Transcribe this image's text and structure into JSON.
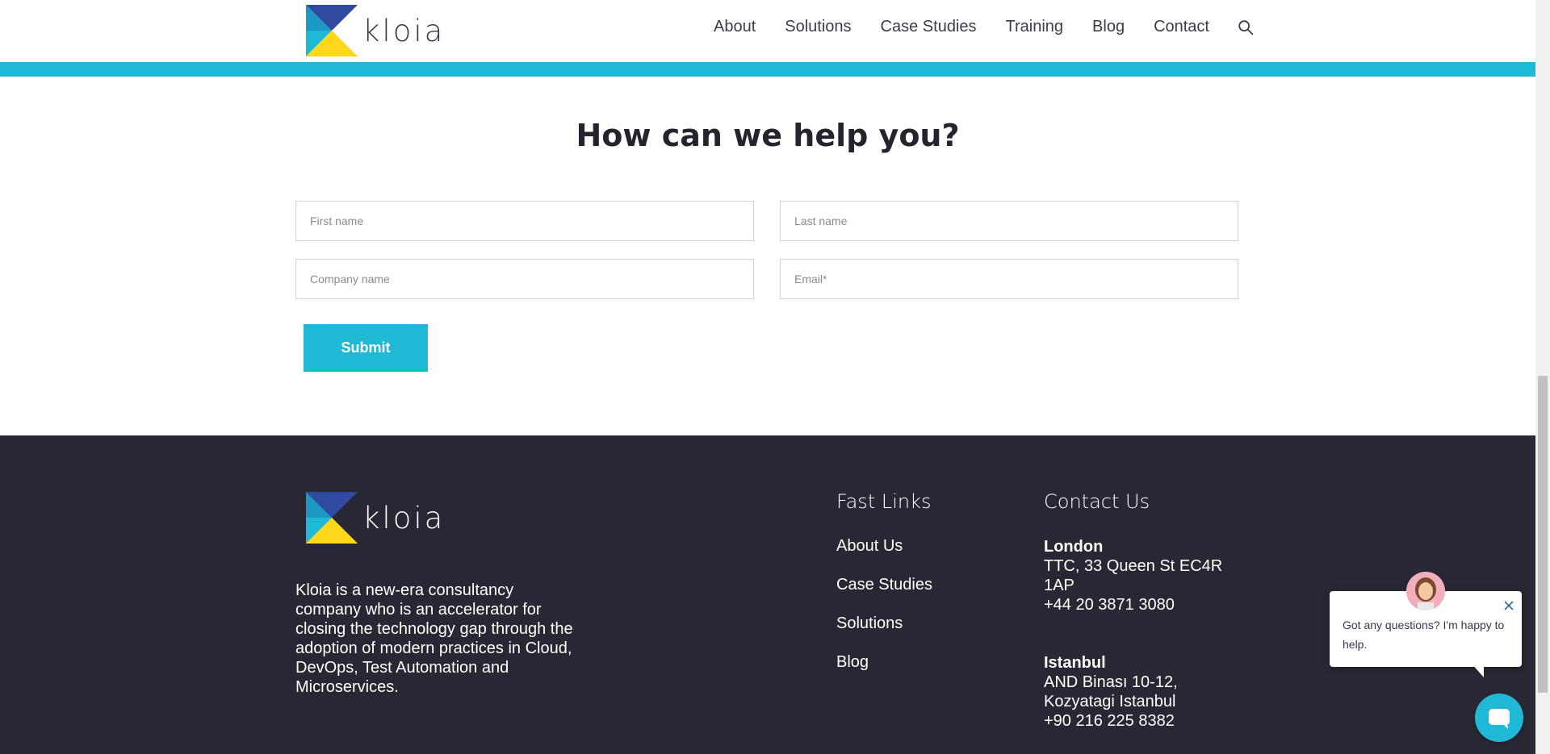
{
  "brand": {
    "name": "kloia",
    "accent_color": "#1fb8d5",
    "footer_bg": "#272833"
  },
  "nav": {
    "items": [
      "About",
      "Solutions",
      "Case Studies",
      "Training",
      "Blog",
      "Contact"
    ],
    "search_icon": "search-icon"
  },
  "form": {
    "title": "How can we help you?",
    "first_name_placeholder": "First name",
    "last_name_placeholder": "Last name",
    "company_placeholder": "Company name",
    "email_placeholder": "Email*",
    "submit_label": "Submit"
  },
  "footer": {
    "description": "Kloia is a new-era consultancy company who is an accelerator for closing the technology gap through the adoption of modern practices in Cloud, DevOps, Test Automation and Microservices.",
    "fast_links": {
      "heading": "Fast Links",
      "items": [
        "About Us",
        "Case Studies",
        "Solutions",
        "Blog"
      ]
    },
    "contact": {
      "heading": "Contact Us",
      "offices": [
        {
          "city": "London",
          "address_1": "TTC, 33 Queen St EC4R",
          "address_2": "1AP",
          "phone": "+44 20 3871 3080"
        },
        {
          "city": "Istanbul",
          "address_1": "AND Binası 10-12,",
          "address_2": "Kozyatagi Istanbul",
          "phone": "+90 216 225 8382"
        }
      ]
    }
  },
  "chat": {
    "message": "Got any questions? I'm happy to help.",
    "close_icon": "close-icon",
    "launcher_icon": "chat-icon"
  }
}
